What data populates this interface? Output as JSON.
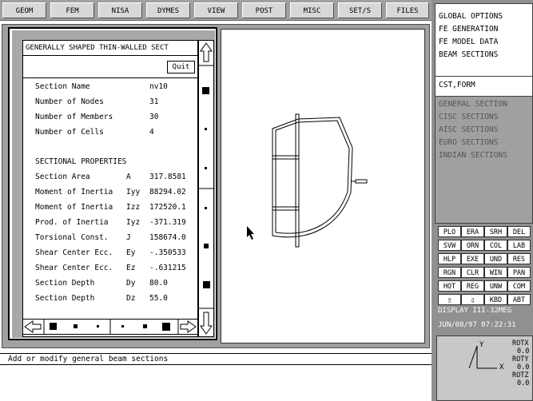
{
  "top_menu": {
    "items": [
      "GEOM",
      "FEM",
      "NISA",
      "DYMES",
      "VIEW",
      "POST",
      "MISC",
      "SET/S",
      "FILES"
    ]
  },
  "right_panel": {
    "options": [
      "GLOBAL OPTIONS",
      "FE GENERATION",
      "FE MODEL DATA",
      "BEAM SECTIONS"
    ],
    "current_cmd": "CST,FORM",
    "sections": [
      "GENERAL SECTION",
      "CISC SECTIONS",
      "AISC SECTIONS",
      "EURO SECTIONS",
      "INDIAN SECTIONS"
    ],
    "keys": [
      [
        "PLO",
        "ERA",
        "SRH",
        "DEL"
      ],
      [
        "SVW",
        "ORN",
        "COL",
        "LAB"
      ],
      [
        "HLP",
        "EXE",
        "UND",
        "RES"
      ],
      [
        "RGN",
        "CLR",
        "WIN",
        "PAN"
      ],
      [
        "HOT",
        "REG",
        "UNW",
        "COM"
      ],
      [
        "⇧",
        "⇩",
        "KBD",
        "ABT"
      ]
    ],
    "display": "DISPLAY III-32MEG",
    "datetime": "JUN/08/97 07:22:31",
    "axis": {
      "y_label": "Y",
      "x_label": "X",
      "rotx_label": "ROTX",
      "rotx_value": "0.0",
      "roty_label": "ROTY",
      "roty_value": "0.0",
      "rotz_label": "ROTZ",
      "rotz_value": "0.0"
    }
  },
  "dialog": {
    "title": "GENERALLY SHAPED THIN-WALLED SECT",
    "quit": "Quit",
    "rows": [
      {
        "label": "Section Name",
        "sym": "",
        "value": "nv10"
      },
      {
        "label": "Number of Nodes",
        "sym": "",
        "value": "31"
      },
      {
        "label": "Number of Members",
        "sym": "",
        "value": "30"
      },
      {
        "label": "Number of Cells",
        "sym": "",
        "value": "4"
      },
      {
        "label": "SECTIONAL PROPERTIES",
        "sym": "",
        "value": ""
      },
      {
        "label": "Section Area",
        "sym": "A",
        "value": "317.8581"
      },
      {
        "label": "Moment of Inertia",
        "sym": "Iyy",
        "value": "88294.02"
      },
      {
        "label": "Moment of Inertia",
        "sym": "Izz",
        "value": "172520.1"
      },
      {
        "label": "Prod. of Inertia",
        "sym": "Iyz",
        "value": "-371.319"
      },
      {
        "label": "Torsional Const.",
        "sym": "J",
        "value": "158674.0"
      },
      {
        "label": "Shear Center Ecc.",
        "sym": "Ey",
        "value": "-.350533"
      },
      {
        "label": "Shear Center Ecc.",
        "sym": "Ez",
        "value": "-.631215"
      },
      {
        "label": "Section Depth",
        "sym": "Dy",
        "value": "80.0"
      },
      {
        "label": "Section Depth",
        "sym": "Dz",
        "value": "55.0"
      }
    ]
  },
  "status": {
    "message": "Add or modify general beam sections"
  }
}
